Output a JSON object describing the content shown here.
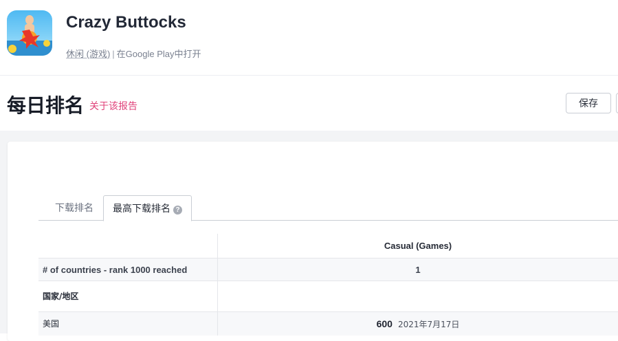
{
  "app": {
    "title": "Crazy Buttocks",
    "category": "休闲 (游戏)",
    "separator": "|",
    "store_link": "在Google Play中打开"
  },
  "report": {
    "title": "每日排名",
    "about_link": "关于该报告",
    "save_label": "保存"
  },
  "tabs": [
    {
      "label": "下载排名",
      "active": false
    },
    {
      "label": "最高下载排名",
      "active": true,
      "help_icon": "?"
    }
  ],
  "table": {
    "column_header": "Casual (Games)",
    "count_label": "# of countries - rank 1000 reached",
    "count_value": "1",
    "country_header": "国家/地区",
    "rows": [
      {
        "country": "美国",
        "rank": "600",
        "date": "2021年7月17日"
      }
    ]
  },
  "colors": {
    "accent_link": "#e0427a",
    "background_band": "#f3f4f6"
  }
}
